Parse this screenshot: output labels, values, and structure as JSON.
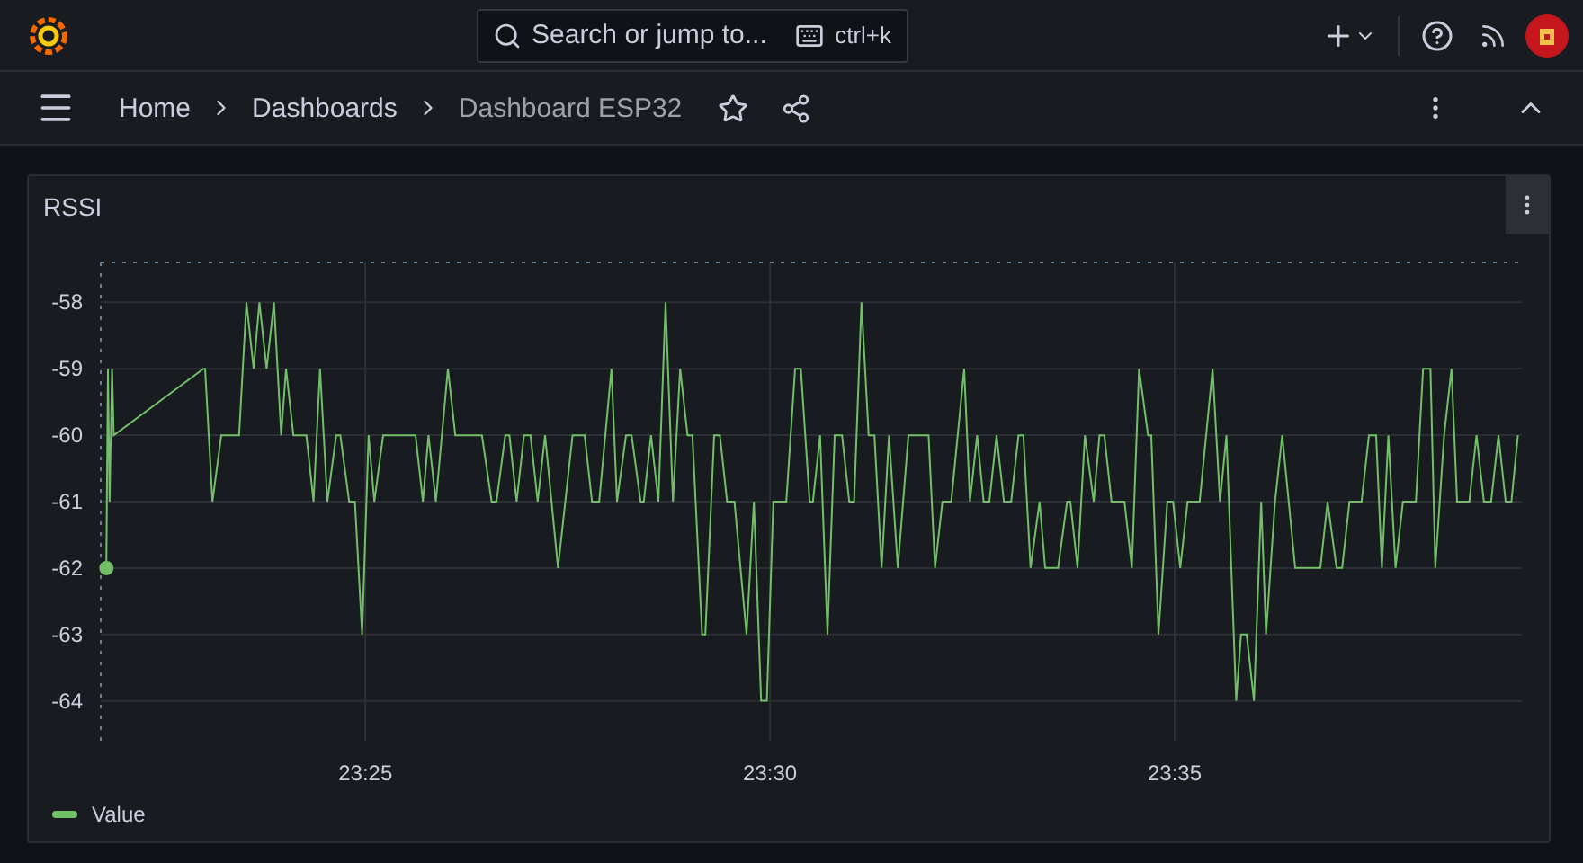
{
  "top_bar": {
    "search": {
      "placeholder": "Search or jump to...",
      "shortcut": "ctrl+k"
    }
  },
  "breadcrumbs": [
    {
      "label": "Home",
      "current": false
    },
    {
      "label": "Dashboards",
      "current": false
    },
    {
      "label": "Dashboard ESP32",
      "current": true
    }
  ],
  "panel": {
    "title": "RSSI",
    "chart_data": {
      "type": "line",
      "x": [
        1401.8,
        1401.82,
        1401.84,
        1401.87,
        1401.89,
        1403.0,
        1403.02,
        1403.11,
        1403.22,
        1403.44,
        1403.53,
        1403.62,
        1403.69,
        1403.78,
        1403.87,
        1403.96,
        1404.02,
        1404.11,
        1404.27,
        1404.36,
        1404.44,
        1404.53,
        1404.64,
        1404.69,
        1404.8,
        1404.87,
        1404.96,
        1405.04,
        1405.11,
        1405.22,
        1405.62,
        1405.71,
        1405.78,
        1405.87,
        1406.02,
        1406.11,
        1406.44,
        1406.56,
        1406.62,
        1406.73,
        1406.78,
        1406.87,
        1406.96,
        1407.04,
        1407.13,
        1407.22,
        1407.38,
        1407.56,
        1407.71,
        1407.8,
        1407.89,
        1408.04,
        1408.11,
        1408.22,
        1408.29,
        1408.4,
        1408.44,
        1408.53,
        1408.62,
        1408.71,
        1408.8,
        1408.89,
        1408.98,
        1409.04,
        1409.16,
        1409.2,
        1409.31,
        1409.38,
        1409.47,
        1409.56,
        1409.71,
        1409.8,
        1409.89,
        1409.96,
        1410.04,
        1410.2,
        1410.31,
        1410.38,
        1410.49,
        1410.53,
        1410.62,
        1410.71,
        1410.8,
        1410.89,
        1410.98,
        1411.04,
        1411.13,
        1411.22,
        1411.29,
        1411.38,
        1411.47,
        1411.58,
        1411.71,
        1411.96,
        1412.04,
        1412.13,
        1412.24,
        1412.4,
        1412.47,
        1412.56,
        1412.64,
        1412.71,
        1412.8,
        1412.89,
        1412.98,
        1413.07,
        1413.13,
        1413.22,
        1413.33,
        1413.4,
        1413.56,
        1413.67,
        1413.71,
        1413.8,
        1413.89,
        1414.0,
        1414.07,
        1414.13,
        1414.22,
        1414.38,
        1414.47,
        1414.56,
        1414.67,
        1414.71,
        1414.8,
        1414.91,
        1414.98,
        1415.07,
        1415.16,
        1415.31,
        1415.47,
        1415.56,
        1415.64,
        1415.76,
        1415.82,
        1415.89,
        1415.98,
        1416.07,
        1416.13,
        1416.24,
        1416.33,
        1416.49,
        1416.8,
        1416.89,
        1417.0,
        1417.07,
        1417.16,
        1417.31,
        1417.4,
        1417.49,
        1417.56,
        1417.64,
        1417.73,
        1417.82,
        1417.98,
        1418.07,
        1418.16,
        1418.22,
        1418.33,
        1418.42,
        1418.49,
        1418.64,
        1418.73,
        1418.82,
        1418.91,
        1419.0,
        1419.09,
        1419.16,
        1419.24
      ],
      "series": [
        {
          "name": "Value",
          "color": "#73bf69",
          "values": [
            -62,
            -59,
            -61,
            -59,
            -60,
            -59,
            -59,
            -61,
            -60,
            -60,
            -58,
            -59,
            -58,
            -59,
            -58,
            -60,
            -59,
            -60,
            -60,
            -61,
            -59,
            -61,
            -60,
            -60,
            -61,
            -61,
            -63,
            -60,
            -61,
            -60,
            -60,
            -61,
            -60,
            -61,
            -59,
            -60,
            -60,
            -61,
            -61,
            -60,
            -60,
            -61,
            -60,
            -60,
            -61,
            -60,
            -62,
            -60,
            -60,
            -61,
            -61,
            -59,
            -61,
            -60,
            -60,
            -61,
            -61,
            -60,
            -61,
            -58,
            -61,
            -59,
            -60,
            -60,
            -63,
            -63,
            -60,
            -60,
            -61,
            -61,
            -63,
            -61,
            -64,
            -64,
            -61,
            -61,
            -59,
            -59,
            -61,
            -61,
            -60,
            -63,
            -60,
            -60,
            -61,
            -61,
            -58,
            -60,
            -60,
            -62,
            -60,
            -62,
            -60,
            -60,
            -62,
            -61,
            -61,
            -59,
            -61,
            -60,
            -61,
            -61,
            -60,
            -61,
            -61,
            -60,
            -60,
            -62,
            -61,
            -62,
            -62,
            -61,
            -61,
            -62,
            -60,
            -61,
            -60,
            -60,
            -61,
            -61,
            -62,
            -59,
            -60,
            -60,
            -63,
            -61,
            -61,
            -62,
            -61,
            -61,
            -59,
            -61,
            -60,
            -64,
            -63,
            -63,
            -64,
            -61,
            -63,
            -61,
            -60,
            -62,
            -62,
            -61,
            -62,
            -62,
            -61,
            -61,
            -60,
            -60,
            -62,
            -60,
            -62,
            -61,
            -61,
            -59,
            -59,
            -62,
            -60,
            -59,
            -61,
            -61,
            -60,
            -61,
            -61,
            -60,
            -61,
            -61,
            -60
          ]
        }
      ],
      "grid": true,
      "xlim": [
        1401.73,
        1419.29
      ],
      "ylim": [
        -64.6,
        -57.4
      ],
      "xticks": [
        {
          "value": 1405,
          "label": "23:25"
        },
        {
          "value": 1410,
          "label": "23:30"
        },
        {
          "value": 1415,
          "label": "23:35"
        }
      ],
      "yticks": [
        -58,
        -59,
        -60,
        -61,
        -62,
        -63,
        -64
      ]
    }
  }
}
